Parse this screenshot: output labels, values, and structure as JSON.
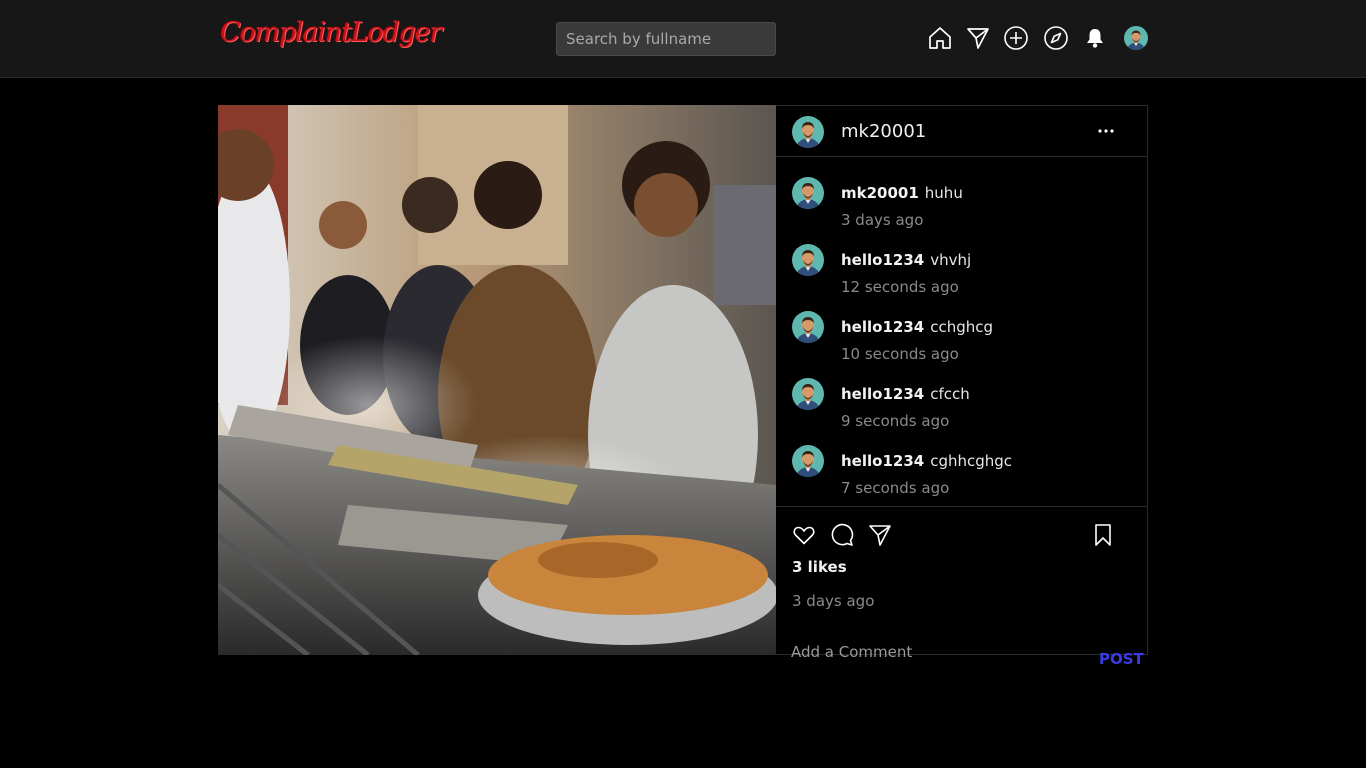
{
  "header": {
    "logo_text": "ComplaintLodger",
    "search_placeholder": "Search by fullname",
    "nav_icons": [
      "home-icon",
      "send-icon",
      "add-post-icon",
      "explore-icon",
      "notifications-icon",
      "profile-avatar"
    ]
  },
  "post": {
    "author": "mk20001",
    "image_description_icon": "post-photo",
    "comments": [
      {
        "user": "mk20001",
        "text": "huhu",
        "time": "3 days ago"
      },
      {
        "user": "hello1234",
        "text": "vhvhj",
        "time": "12 seconds ago"
      },
      {
        "user": "hello1234",
        "text": "cchghcg",
        "time": "10 seconds ago"
      },
      {
        "user": "hello1234",
        "text": "cfcch",
        "time": "9 seconds ago"
      },
      {
        "user": "hello1234",
        "text": "cghhcghgc",
        "time": "7 seconds ago"
      }
    ],
    "likes_text": "3 likes",
    "posted_time": "3 days ago",
    "comment_placeholder": "Add a Comment",
    "post_button": "POST"
  },
  "colors": {
    "background": "#000000",
    "header_bg": "#171717",
    "logo": "#c8141c",
    "post_button": "#3c3ce6",
    "muted_text": "#8a8a8a"
  }
}
